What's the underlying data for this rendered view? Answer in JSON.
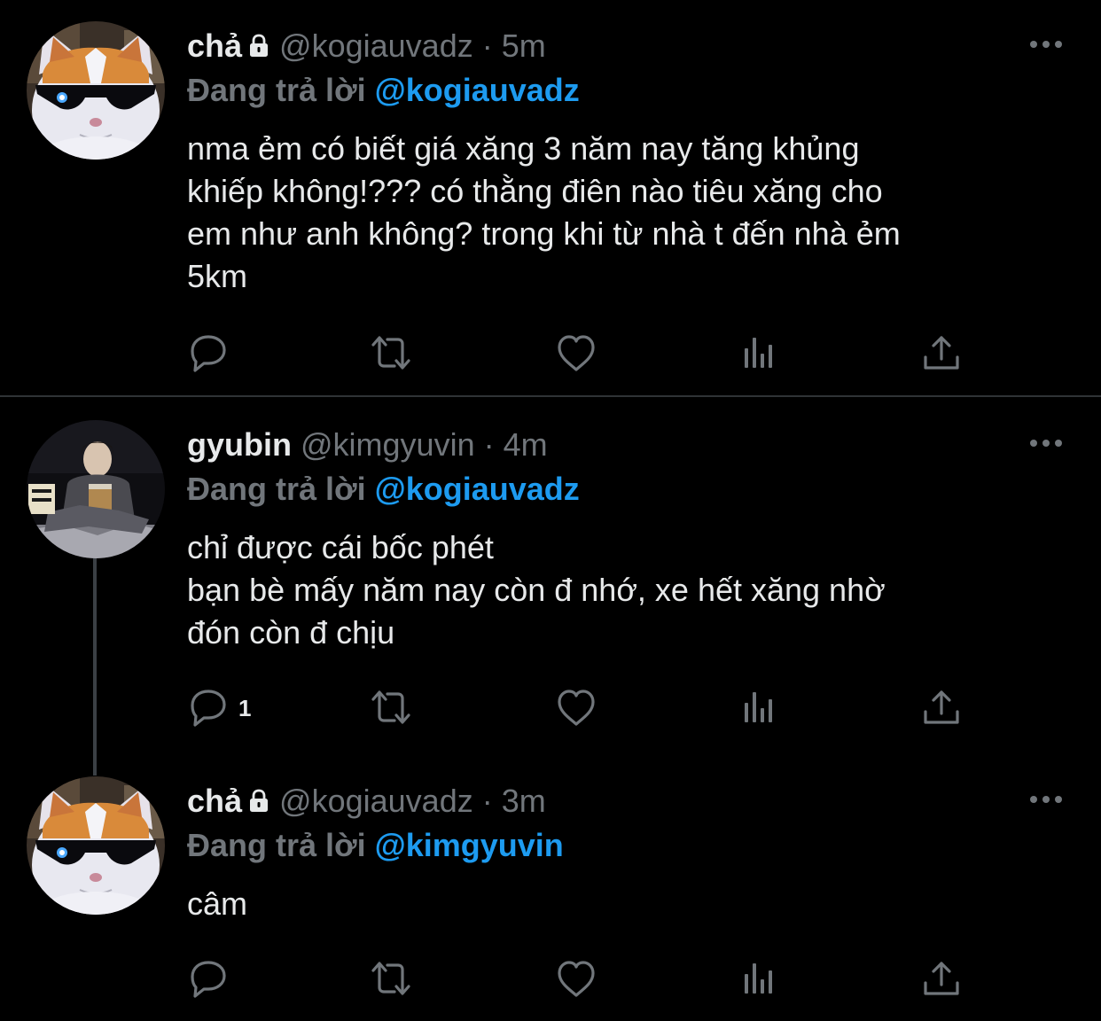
{
  "tweets": [
    {
      "name": "chả",
      "handle": "@kogiauvadz",
      "dot": "·",
      "time": "5m",
      "replying_label": "Đang trả lời",
      "replying_to": "@kogiauvadz",
      "text": "nma ẻm có biết giá xăng 3 năm nay tăng khủng\nkhiếp không!??? có thằng điên nào tiêu xăng cho\nem như anh không? trong khi từ nhà t đến nhà ẻm\n5km",
      "reply_count": "",
      "locked": true
    },
    {
      "name": "gyubin",
      "handle": "@kimgyuvin",
      "dot": "·",
      "time": "4m",
      "replying_label": "Đang trả lời",
      "replying_to": "@kogiauvadz",
      "text": "chỉ được cái bốc phét\nbạn bè mấy năm nay còn đ nhớ, xe hết xăng nhờ\nđón còn đ chịu",
      "reply_count": "1",
      "locked": false
    },
    {
      "name": "chả",
      "handle": "@kogiauvadz",
      "dot": "·",
      "time": "3m",
      "replying_label": "Đang trả lời",
      "replying_to": "@kimgyuvin",
      "text": "câm",
      "reply_count": "",
      "locked": true
    }
  ],
  "icons": {
    "lock": "lock-icon",
    "more": "more-icon",
    "reply": "reply-icon",
    "retweet": "retweet-icon",
    "like": "heart-icon",
    "views": "views-icon",
    "share": "share-icon"
  },
  "colors": {
    "background": "#000000",
    "text": "#e7e9ea",
    "secondary": "#71767b",
    "mention": "#1d9bf0",
    "divider": "#2f3336",
    "thread_line": "#3b4045"
  }
}
